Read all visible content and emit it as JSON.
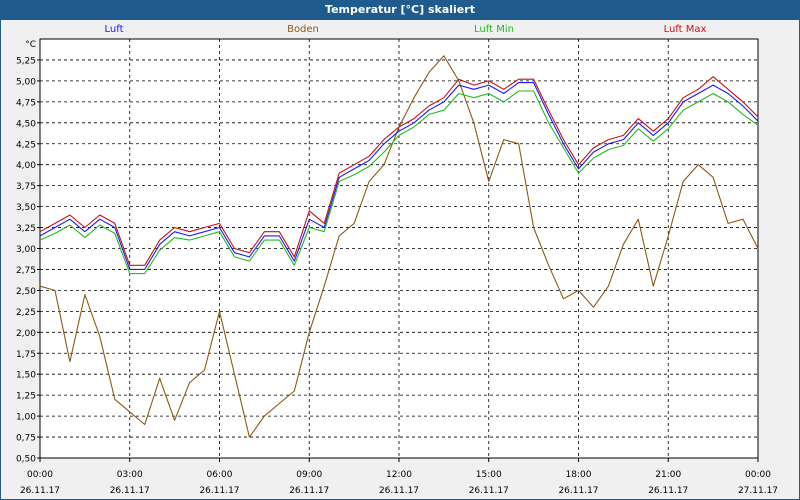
{
  "window": {
    "title": "Temperatur [°C] skaliert"
  },
  "legend": [
    {
      "label": "Luft",
      "color": "#1a1aff"
    },
    {
      "label": "Boden",
      "color": "#8b5a14"
    },
    {
      "label": "Luft Min",
      "color": "#22bb22"
    },
    {
      "label": "Luft Max",
      "color": "#cc1111"
    }
  ],
  "chart_data": {
    "type": "line",
    "title": "Temperatur [°C] skaliert",
    "ylabel": "°C",
    "xlabel": "",
    "xlim": [
      0,
      24
    ],
    "ylim": [
      0.5,
      5.5
    ],
    "grid": true,
    "legend_position": "top",
    "yticks": [
      "0,50",
      "0,75",
      "1,00",
      "1,25",
      "1,50",
      "1,75",
      "2,00",
      "2,25",
      "2,50",
      "2,75",
      "3,00",
      "3,25",
      "3,50",
      "3,75",
      "4,00",
      "4,25",
      "4,50",
      "4,75",
      "5,00",
      "5,25"
    ],
    "xticks": [
      {
        "time": "00:00",
        "date": "26.11.17"
      },
      {
        "time": "03:00",
        "date": "26.11.17"
      },
      {
        "time": "06:00",
        "date": "26.11.17"
      },
      {
        "time": "09:00",
        "date": "26.11.17"
      },
      {
        "time": "12:00",
        "date": "26.11.17"
      },
      {
        "time": "15:00",
        "date": "26.11.17"
      },
      {
        "time": "18:00",
        "date": "26.11.17"
      },
      {
        "time": "21:00",
        "date": "26.11.17"
      },
      {
        "time": "00:00",
        "date": "27.11.17"
      }
    ],
    "x": [
      0,
      0.5,
      1,
      1.5,
      2,
      2.5,
      3,
      3.5,
      4,
      4.5,
      5,
      5.5,
      6,
      6.5,
      7,
      7.5,
      8,
      8.5,
      9,
      9.5,
      10,
      10.5,
      11,
      11.5,
      12,
      12.5,
      13,
      13.5,
      14,
      14.5,
      15,
      15.5,
      16,
      16.5,
      17,
      17.5,
      18,
      18.5,
      19,
      19.5,
      20,
      20.5,
      21,
      21.5,
      22,
      22.5,
      23,
      23.5,
      24
    ],
    "series": [
      {
        "name": "Luft",
        "color": "#1a1aff",
        "values": [
          3.15,
          3.25,
          3.35,
          3.2,
          3.35,
          3.25,
          2.75,
          2.75,
          3.05,
          3.2,
          3.15,
          3.2,
          3.25,
          2.95,
          2.9,
          3.15,
          3.15,
          2.85,
          3.35,
          3.25,
          3.85,
          3.95,
          4.05,
          4.25,
          4.4,
          4.5,
          4.65,
          4.75,
          4.95,
          4.9,
          4.95,
          4.85,
          4.98,
          4.98,
          4.6,
          4.25,
          3.95,
          4.15,
          4.25,
          4.3,
          4.5,
          4.35,
          4.5,
          4.75,
          4.85,
          4.95,
          4.85,
          4.7,
          4.52
        ]
      },
      {
        "name": "Boden",
        "color": "#8b5a14",
        "values": [
          2.55,
          2.5,
          1.65,
          2.45,
          1.95,
          1.2,
          1.05,
          0.9,
          1.45,
          0.95,
          1.4,
          1.55,
          2.25,
          1.5,
          0.75,
          1.0,
          1.15,
          1.3,
          2.0,
          2.55,
          3.15,
          3.3,
          3.8,
          4.0,
          4.45,
          4.8,
          5.1,
          5.3,
          5.0,
          4.5,
          3.8,
          4.3,
          4.25,
          3.25,
          2.8,
          2.4,
          2.5,
          2.3,
          2.55,
          3.05,
          3.35,
          2.55,
          3.15,
          3.8,
          4.0,
          3.85,
          3.3,
          3.35,
          3.0
        ]
      },
      {
        "name": "Luft Min",
        "color": "#22bb22",
        "values": [
          3.1,
          3.18,
          3.28,
          3.13,
          3.28,
          3.18,
          2.7,
          2.7,
          2.98,
          3.13,
          3.1,
          3.15,
          3.2,
          2.9,
          2.85,
          3.1,
          3.1,
          2.8,
          3.25,
          3.2,
          3.8,
          3.88,
          3.98,
          4.15,
          4.35,
          4.45,
          4.6,
          4.65,
          4.85,
          4.8,
          4.85,
          4.75,
          4.88,
          4.88,
          4.5,
          4.2,
          3.9,
          4.08,
          4.18,
          4.23,
          4.43,
          4.28,
          4.43,
          4.65,
          4.75,
          4.85,
          4.75,
          4.6,
          4.47
        ]
      },
      {
        "name": "Luft Max",
        "color": "#cc1111",
        "values": [
          3.2,
          3.3,
          3.4,
          3.25,
          3.4,
          3.3,
          2.8,
          2.8,
          3.1,
          3.25,
          3.2,
          3.25,
          3.3,
          3.0,
          2.95,
          3.2,
          3.2,
          2.9,
          3.45,
          3.3,
          3.9,
          4.0,
          4.1,
          4.3,
          4.45,
          4.55,
          4.7,
          4.8,
          5.02,
          4.95,
          5.0,
          4.9,
          5.02,
          5.02,
          4.65,
          4.3,
          4.0,
          4.2,
          4.3,
          4.35,
          4.55,
          4.4,
          4.55,
          4.8,
          4.9,
          5.05,
          4.9,
          4.75,
          4.57
        ]
      }
    ]
  }
}
